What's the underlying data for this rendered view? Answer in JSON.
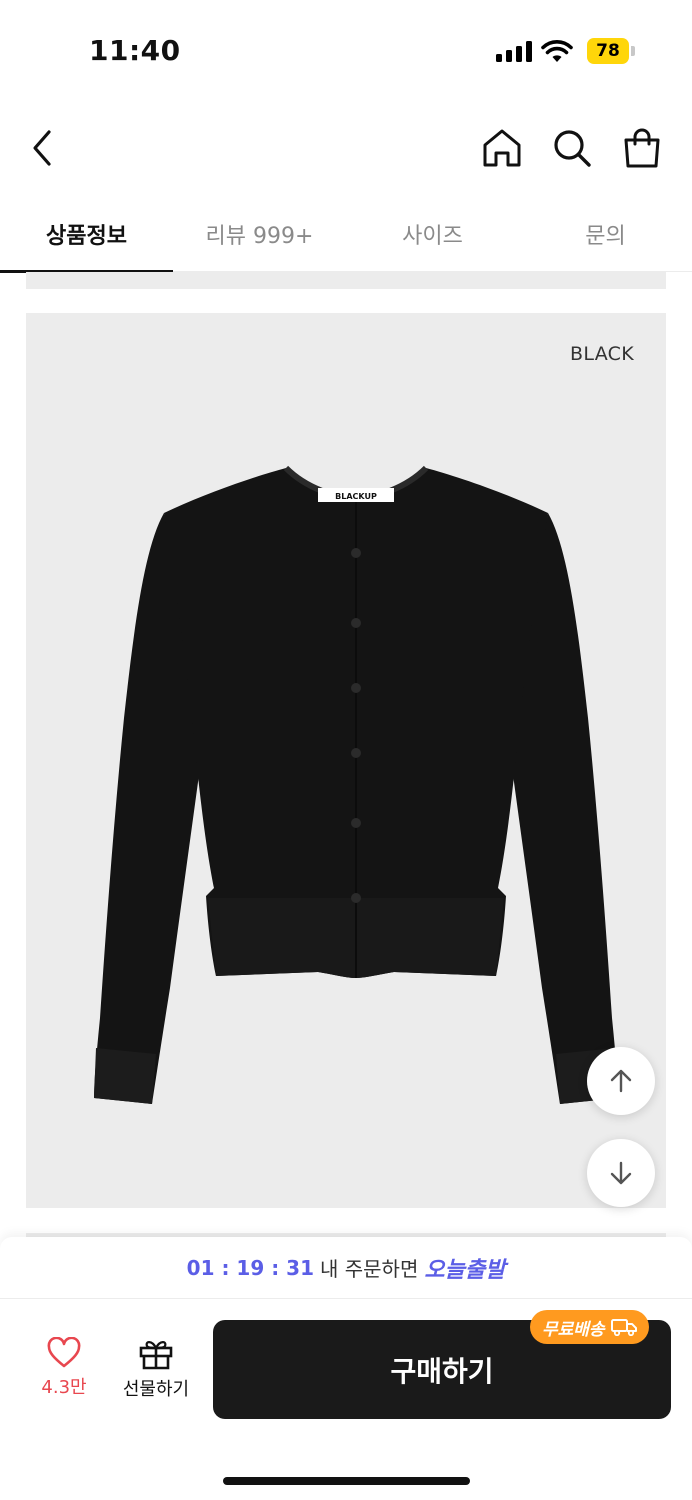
{
  "status_bar": {
    "time": "11:40",
    "battery": "78",
    "icons": [
      "signal-icon",
      "wifi-icon",
      "battery-icon"
    ]
  },
  "nav": {
    "icons": [
      "back-icon",
      "home-icon",
      "search-icon",
      "shopping-bag-icon"
    ]
  },
  "tabs": [
    {
      "label": "상품정보",
      "active": true
    },
    {
      "label": "리뷰 999+",
      "active": false
    },
    {
      "label": "사이즈",
      "active": false
    },
    {
      "label": "문의",
      "active": false
    }
  ],
  "product_image": {
    "color_label": "BLACK",
    "brand_tag": "BLACKUP",
    "background": "#ececec",
    "garment_color": "#141414"
  },
  "floating_buttons": {
    "icons": [
      "arrow-up-icon",
      "arrow-down-icon"
    ]
  },
  "bottom_bar": {
    "countdown": "01 : 19 : 31",
    "shipping_text": "내 주문하면",
    "shipping_highlight": "오늘출발",
    "wish_count": "4.3만",
    "gift_label": "선물하기",
    "buy_label": "구매하기",
    "free_shipping_badge": "무료배송"
  },
  "colors": {
    "accent": "#5b5ee6",
    "wish": "#e8474f",
    "badge": "#ff9a1f",
    "buy_button": "#1a1a1a"
  }
}
